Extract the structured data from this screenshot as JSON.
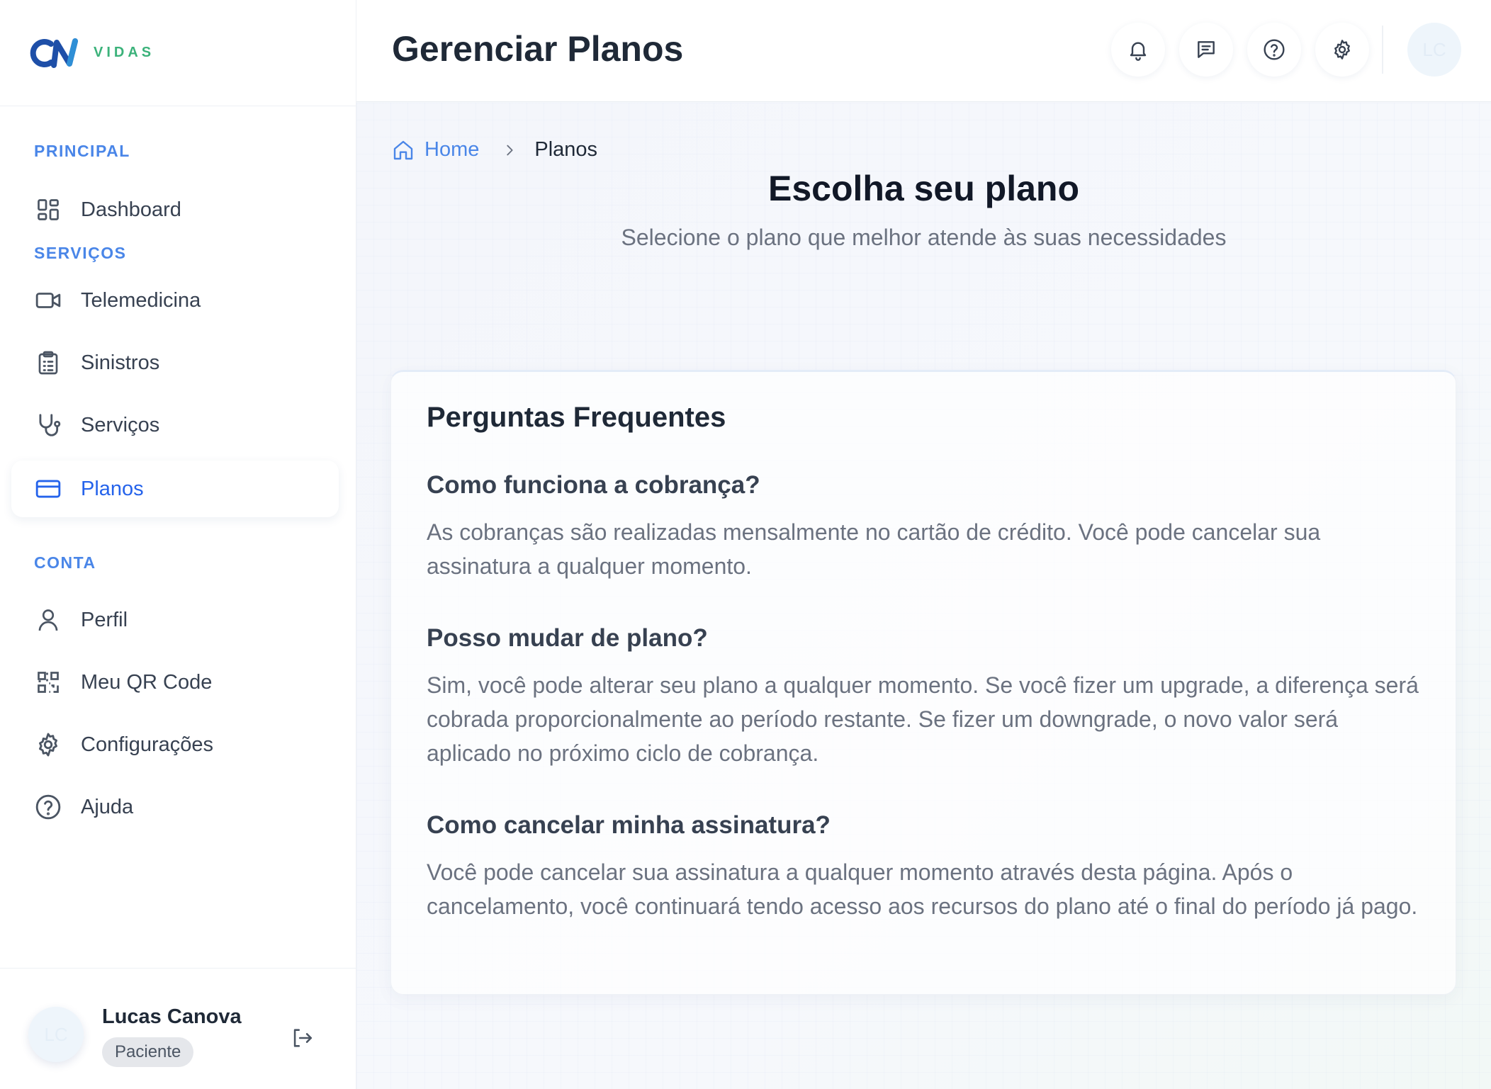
{
  "brand": {
    "mark": "CN",
    "name": "VIDAS"
  },
  "sidebar": {
    "sections": [
      {
        "label": "PRINCIPAL"
      },
      {
        "label": "SERVIÇOS"
      },
      {
        "label": "CONTA"
      }
    ],
    "items": [
      {
        "label": "Dashboard",
        "icon": "dashboard-icon"
      },
      {
        "label": "Telemedicina",
        "icon": "video-camera-icon"
      },
      {
        "label": "Sinistros",
        "icon": "clipboard-list-icon"
      },
      {
        "label": "Serviços",
        "icon": "stethoscope-icon"
      },
      {
        "label": "Planos",
        "icon": "credit-card-icon",
        "active": true
      },
      {
        "label": "Perfil",
        "icon": "user-icon"
      },
      {
        "label": "Meu QR Code",
        "icon": "qr-code-icon"
      },
      {
        "label": "Configurações",
        "icon": "gear-icon"
      },
      {
        "label": "Ajuda",
        "icon": "help-circle-icon"
      }
    ]
  },
  "user": {
    "initials": "LC",
    "name": "Lucas Canova",
    "role": "Paciente"
  },
  "header": {
    "title": "Gerenciar Planos",
    "avatar_initials": "LC"
  },
  "breadcrumb": {
    "home": "Home",
    "current": "Planos"
  },
  "hero": {
    "title": "Escolha seu plano",
    "subtitle": "Selecione o plano que melhor atende às suas necessidades"
  },
  "faq": {
    "heading": "Perguntas Frequentes",
    "items": [
      {
        "question": "Como funciona a cobrança?",
        "answer": "As cobranças são realizadas mensalmente no cartão de crédito. Você pode cancelar sua assinatura a qualquer momento."
      },
      {
        "question": "Posso mudar de plano?",
        "answer": "Sim, você pode alterar seu plano a qualquer momento. Se você fizer um upgrade, a diferença será cobrada proporcionalmente ao período restante. Se fizer um downgrade, o novo valor será aplicado no próximo ciclo de cobrança."
      },
      {
        "question": "Como cancelar minha assinatura?",
        "answer": "Você pode cancelar sua assinatura a qualquer momento através desta página. Após o cancelamento, você continuará tendo acesso aos recursos do plano até o final do período já pago."
      }
    ]
  },
  "colors": {
    "accent": "#2563eb",
    "section_label": "#4a86e8",
    "brand_green": "#3bb27a",
    "brand_blue": "#1e4fa8"
  }
}
